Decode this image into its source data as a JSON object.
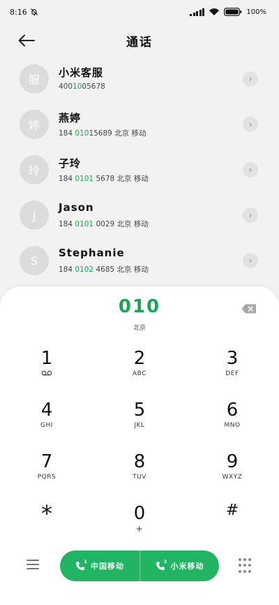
{
  "status": {
    "time": "8:16",
    "battery": "100%"
  },
  "header": {
    "title": "通话"
  },
  "contacts": [
    {
      "avatar": "服",
      "name": "小米客服",
      "num_pre": "400",
      "num_hl": "10",
      "num_post": "05678",
      "location": ""
    },
    {
      "avatar": "婷",
      "name": "燕婷",
      "num_pre": "184 ",
      "num_hl": "010",
      "num_post": "15689",
      "location": "北京 移动"
    },
    {
      "avatar": "玲",
      "name": "子玲",
      "num_pre": "184 ",
      "num_hl": "0101",
      "num_post": " 5678",
      "location": "北京 移动"
    },
    {
      "avatar": "J",
      "name": "Jason",
      "num_pre": "184 ",
      "num_hl": "0101",
      "num_post": " 0029",
      "location": "北京 移动"
    },
    {
      "avatar": "S",
      "name": "Stephanie",
      "num_pre": "184 ",
      "num_hl": "0102",
      "num_post": " 4685",
      "location": "北京 移动"
    }
  ],
  "dialer": {
    "input": "010",
    "location": "北京",
    "keys": [
      {
        "digit": "1",
        "letters": ""
      },
      {
        "digit": "2",
        "letters": "ABC"
      },
      {
        "digit": "3",
        "letters": "DEF"
      },
      {
        "digit": "4",
        "letters": "GHI"
      },
      {
        "digit": "5",
        "letters": "JKL"
      },
      {
        "digit": "6",
        "letters": "MNO"
      },
      {
        "digit": "7",
        "letters": "PQRS"
      },
      {
        "digit": "8",
        "letters": "TUV"
      },
      {
        "digit": "9",
        "letters": "WXYZ"
      },
      {
        "digit": "*",
        "letters": ""
      },
      {
        "digit": "0",
        "letters": "+"
      },
      {
        "digit": "#",
        "letters": ""
      }
    ]
  },
  "call_buttons": {
    "sim1_label": "中国移动",
    "sim1_index": "1",
    "sim2_label": "小米移动",
    "sim2_index": "2"
  },
  "colors": {
    "accent": "#21b563",
    "highlight": "#19a558",
    "avatar_bg": "#dcdcdc"
  }
}
